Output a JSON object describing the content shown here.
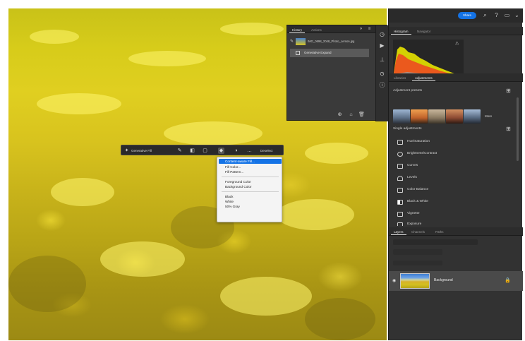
{
  "topbar": {
    "share_label": "Share"
  },
  "histogram_tabs": [
    "Histogram",
    "Navigator"
  ],
  "adj_tabs": [
    "Libraries",
    "Adjustments"
  ],
  "adjustments": {
    "presets_title": "Adjustment presets",
    "more_label": "More",
    "single_title": "Single adjustments",
    "items": [
      "Hue/Saturation",
      "Brightness/Contrast",
      "Curves",
      "Levels",
      "Color Balance",
      "Black & White",
      "Vignette",
      "Exposure"
    ]
  },
  "layers_tabs": [
    "Layers",
    "Channels",
    "Paths"
  ],
  "layer": {
    "name": "Background"
  },
  "history": {
    "tabs": [
      "History",
      "Actions"
    ],
    "items": [
      "IMG_0698_2048_Photo_Lemon.jpg",
      "Generative Expand"
    ]
  },
  "ctxbar": {
    "generative_fill_label": "Generative Fill",
    "deselect_label": "Deselect"
  },
  "dropdown": {
    "groups": [
      [
        "Content-aware Fill...",
        "Fill Color...",
        "Fill Pattern..."
      ],
      [
        "Foreground Color",
        "Background Color"
      ],
      [
        "Black",
        "White",
        "50% Gray"
      ]
    ],
    "selected": "Content-aware Fill..."
  },
  "colors": {
    "accent": "#1473e6",
    "panel_bg": "#323232",
    "canvas_yellow": "#d7cc1a"
  }
}
